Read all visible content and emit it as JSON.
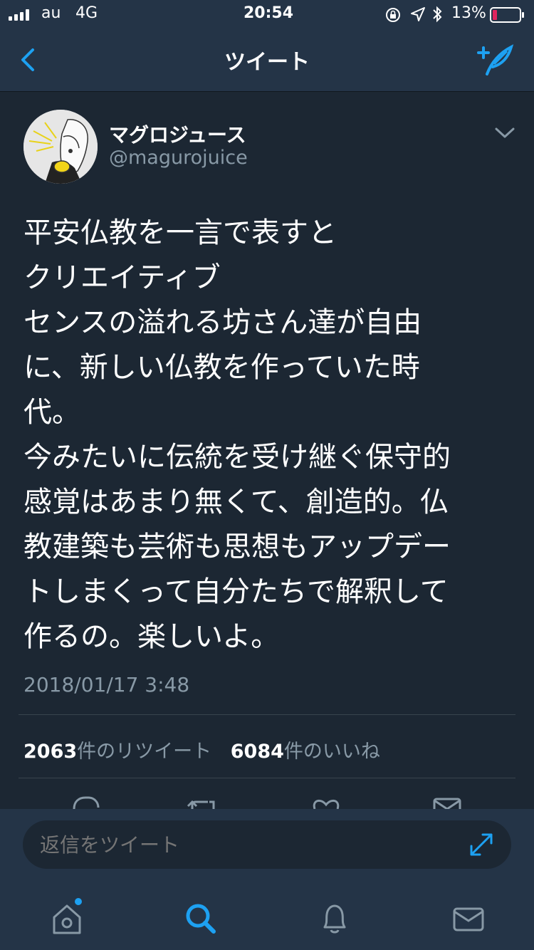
{
  "status_bar": {
    "carrier": "au",
    "network": "4G",
    "time": "20:54",
    "battery": "13%"
  },
  "nav": {
    "title": "ツイート",
    "back_icon": "chevron-left-icon",
    "compose_icon": "compose-tweet-icon"
  },
  "tweet": {
    "display_name": "マグロジュース",
    "handle": "@magurojuice",
    "text": "平安仏教を一言で表すと\nクリエイティブ\nセンスの溢れる坊さん達が自由\nに、新しい仏教を作っていた時\n代。\n今みたいに伝統を受け継ぐ保守的\n感覚はあまり無くて、創造的。仏\n教建築も芸術も思想もアップデー\nトしまくって自分たちで解釈して\n作るの。楽しいよ。",
    "timestamp": "2018/01/17 3:48",
    "retweet_count": "2063",
    "retweet_label": "件のリツイート",
    "like_count": "6084",
    "like_label": "件のいいね"
  },
  "reply": {
    "placeholder": "返信をツイート"
  },
  "tabs": [
    "home-icon",
    "search-icon",
    "notifications-icon",
    "messages-icon"
  ],
  "colors": {
    "background": "#1c2733",
    "bar": "#243447",
    "accent": "#1da1f2",
    "secondary_text": "#8899a6",
    "battery_low": "#e0245e"
  }
}
